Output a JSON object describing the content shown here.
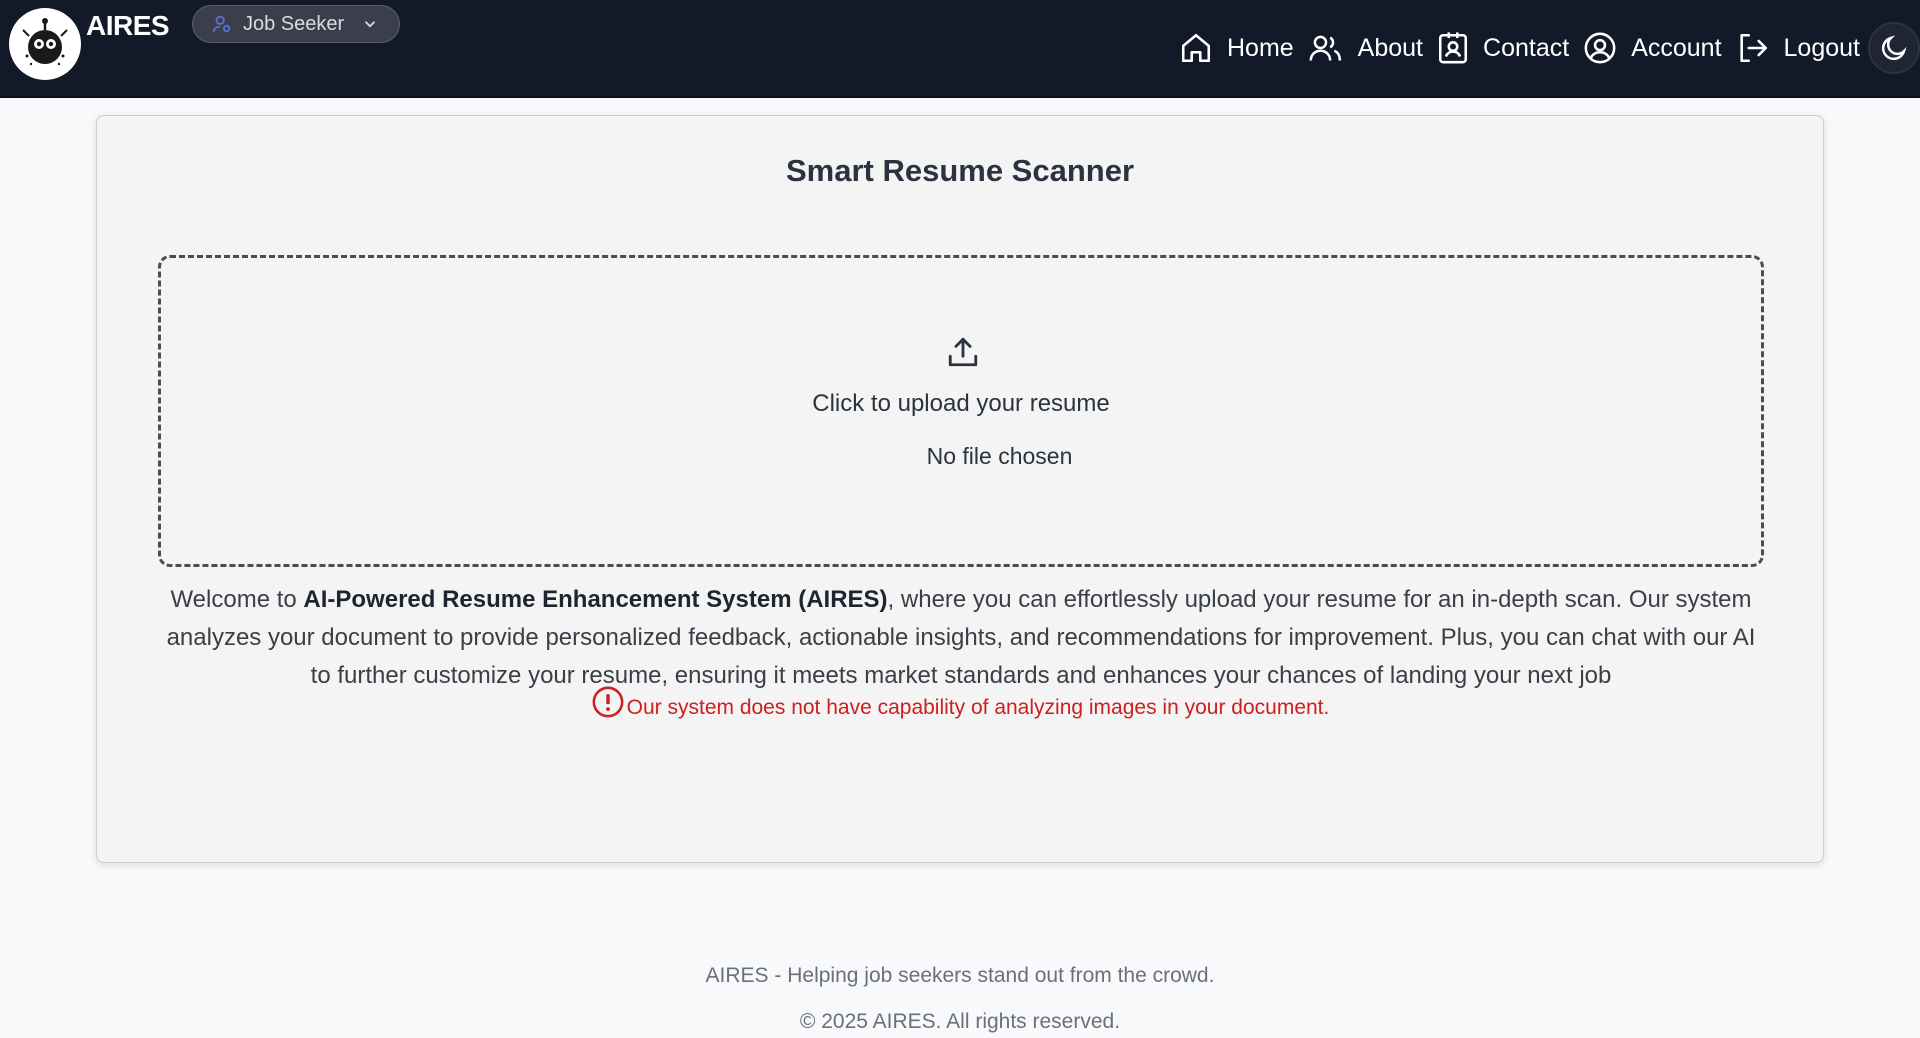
{
  "header": {
    "brand": "AIRES",
    "role_selector": {
      "selected": "Job Seeker"
    },
    "nav": {
      "home": "Home",
      "about": "About",
      "contact": "Contact",
      "account": "Account",
      "logout": "Logout"
    },
    "icons": {
      "home": "home-icon",
      "about": "users-icon",
      "contact": "contact-card-icon",
      "account": "user-circle-icon",
      "logout": "logout-icon",
      "theme": "moon-icon"
    }
  },
  "main": {
    "title": "Smart Resume Scanner",
    "upload": {
      "label": "Click to upload your resume",
      "file_status": "No file chosen"
    },
    "welcome": {
      "prefix": "Welcome to ",
      "system_name": "AI-Powered Resume Enhancement System (AIRES)",
      "suffix": ", where you can effortlessly upload your resume for an in-depth scan. Our system analyzes your document to provide personalized feedback, actionable insights, and recommendations for improvement. Plus, you can chat with our AI to further customize your resume, ensuring it meets market standards and enhances your chances of landing your next job"
    },
    "warning": "Our system does not have capability of analyzing images in your document."
  },
  "footer": {
    "tagline": "AIRES - Helping job seekers stand out from the crowd.",
    "copyright": "© 2025 AIRES. All rights reserved."
  },
  "colors": {
    "navbar": "#121a29",
    "warning": "#cc1f1f",
    "role_icon": "#5b6fd6"
  }
}
